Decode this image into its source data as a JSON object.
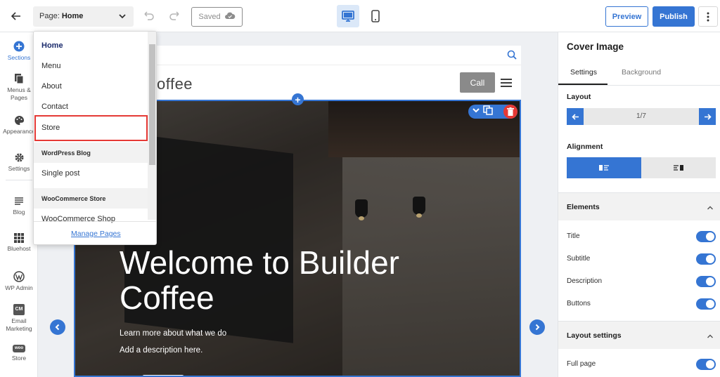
{
  "topbar": {
    "page_prefix": "Page:",
    "page_name": "Home",
    "saved_label": "Saved",
    "preview_label": "Preview",
    "publish_label": "Publish"
  },
  "sidebar": {
    "items": [
      {
        "label": "Sections",
        "icon": "plus-circle-icon"
      },
      {
        "label": "Menus & Pages",
        "icon": "pages-icon"
      },
      {
        "label": "Appearance",
        "icon": "palette-icon"
      },
      {
        "label": "Settings",
        "icon": "gear-icon"
      },
      {
        "label": "Blog",
        "icon": "blog-icon"
      },
      {
        "label": "Bluehost",
        "icon": "grid-icon"
      },
      {
        "label": "WP Admin",
        "icon": "wordpress-icon"
      },
      {
        "label": "Email Marketing",
        "icon": "cm-icon"
      },
      {
        "label": "Store",
        "icon": "woo-icon"
      }
    ]
  },
  "dropdown": {
    "items": [
      "Home",
      "Menu",
      "About",
      "Contact",
      "Store"
    ],
    "group1": "WordPress Blog",
    "group1_items": [
      "Single post"
    ],
    "group2": "WooCommerce Store",
    "group2_items": [
      "WooCommerce Shop"
    ],
    "manage_label": "Manage Pages"
  },
  "site": {
    "title_partial": "offee",
    "call_label": "Call",
    "cover_title": "Welcome to Builder Coffee",
    "cover_subtitle": "Learn more about what we do",
    "cover_description": "Add a description here."
  },
  "panel": {
    "title": "Cover Image",
    "tabs": [
      "Settings",
      "Background"
    ],
    "layout_label": "Layout",
    "layout_value": "1/7",
    "alignment_label": "Alignment",
    "elements_label": "Elements",
    "elements": [
      "Title",
      "Subtitle",
      "Description",
      "Buttons"
    ],
    "layout_settings_label": "Layout settings",
    "full_page_label": "Full page"
  },
  "colors": {
    "accent": "#3575d3",
    "danger": "#e53935"
  }
}
